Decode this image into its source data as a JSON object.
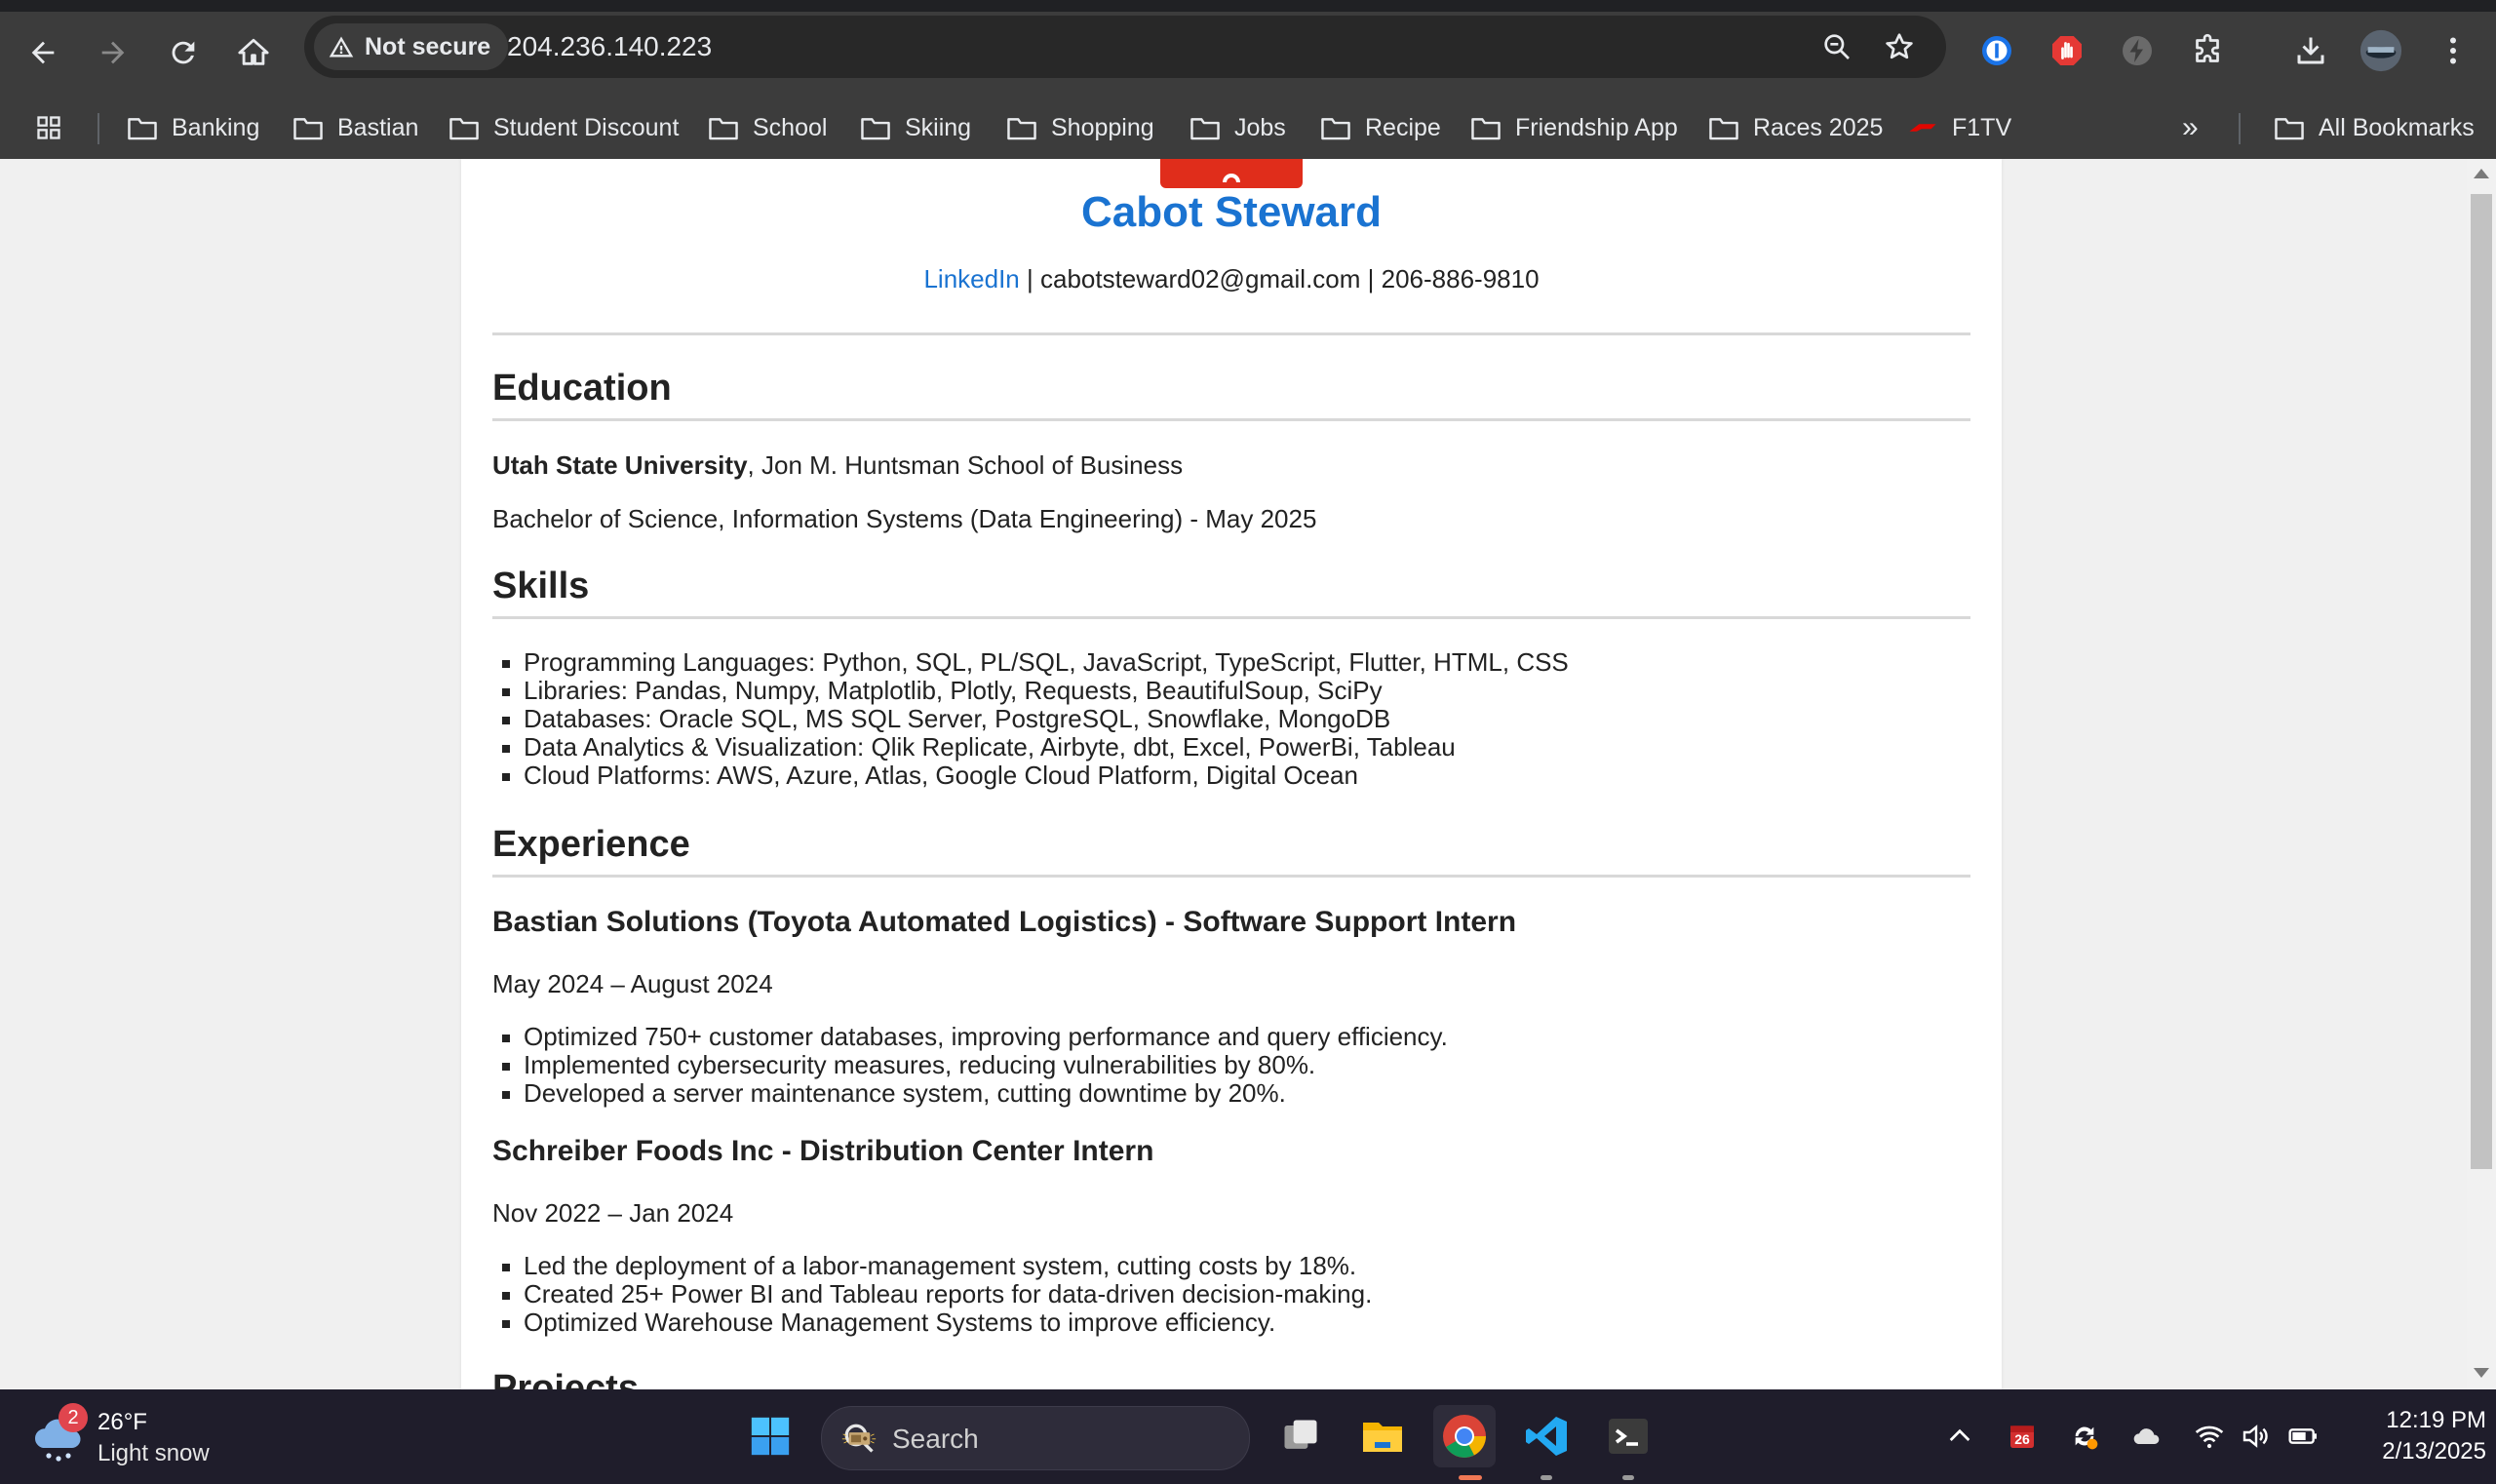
{
  "browser": {
    "security_label": "Not secure",
    "url": "204.236.140.223",
    "bookmarks": [
      {
        "label": "Banking",
        "icon": "folder-icon"
      },
      {
        "label": "Bastian",
        "icon": "folder-icon"
      },
      {
        "label": "Student Discount",
        "icon": "folder-icon"
      },
      {
        "label": "School",
        "icon": "folder-icon"
      },
      {
        "label": "Skiing",
        "icon": "folder-icon"
      },
      {
        "label": "Shopping",
        "icon": "folder-icon"
      },
      {
        "label": "Jobs",
        "icon": "folder-icon"
      },
      {
        "label": "Recipe",
        "icon": "folder-icon"
      },
      {
        "label": "Friendship App",
        "icon": "folder-icon"
      },
      {
        "label": "Races 2025",
        "icon": "folder-icon"
      },
      {
        "label": "F1TV",
        "icon": "f1-icon"
      }
    ],
    "overflow_label": "»",
    "all_bookmarks": "All Bookmarks"
  },
  "resume": {
    "name": "Cabot Steward",
    "contact": {
      "linkedin": "LinkedIn",
      "rest": " | cabotsteward02@gmail.com | 206-886-9810"
    },
    "education": {
      "heading": "Education",
      "school": "Utah State University",
      "school_rest": ", Jon M. Huntsman School of Business",
      "degree": "Bachelor of Science, Information Systems (Data Engineering) - May 2025"
    },
    "skills": {
      "heading": "Skills",
      "items": [
        "Programming Languages: Python, SQL, PL/SQL, JavaScript, TypeScript, Flutter, HTML, CSS",
        "Libraries: Pandas, Numpy, Matplotlib, Plotly, Requests, BeautifulSoup, SciPy",
        "Databases: Oracle SQL, MS SQL Server, PostgreSQL, Snowflake, MongoDB",
        "Data Analytics & Visualization: Qlik Replicate, Airbyte, dbt, Excel, PowerBi, Tableau",
        "Cloud Platforms: AWS, Azure, Atlas, Google Cloud Platform, Digital Ocean"
      ]
    },
    "experience": {
      "heading": "Experience",
      "jobs": [
        {
          "title": "Bastian Solutions (Toyota Automated Logistics) - Software Support Intern",
          "dates": "May 2024 – August 2024",
          "bullets": [
            "Optimized 750+ customer databases, improving performance and query efficiency.",
            "Implemented cybersecurity measures, reducing vulnerabilities by 80%.",
            "Developed a server maintenance system, cutting downtime by 20%."
          ]
        },
        {
          "title": "Schreiber Foods Inc - Distribution Center Intern",
          "dates": "Nov 2022 – Jan 2024",
          "bullets": [
            "Led the deployment of a labor-management system, cutting costs by 18%.",
            "Created 25+ Power BI and Tableau reports for data-driven decision-making.",
            "Optimized Warehouse Management Systems to improve efficiency."
          ]
        }
      ]
    },
    "projects": {
      "heading": "Projects"
    }
  },
  "taskbar": {
    "weather_badge": "2",
    "temperature": "26°F",
    "condition": "Light snow",
    "search_placeholder": "Search",
    "tray_badge": "26",
    "time": "12:19 PM",
    "date": "2/13/2025"
  },
  "colors": {
    "link_blue": "#1a73d1",
    "brand_red": "#e02d1b",
    "chrome_bg": "#3c3c3c",
    "taskbar_bg": "#1f1d2b"
  }
}
